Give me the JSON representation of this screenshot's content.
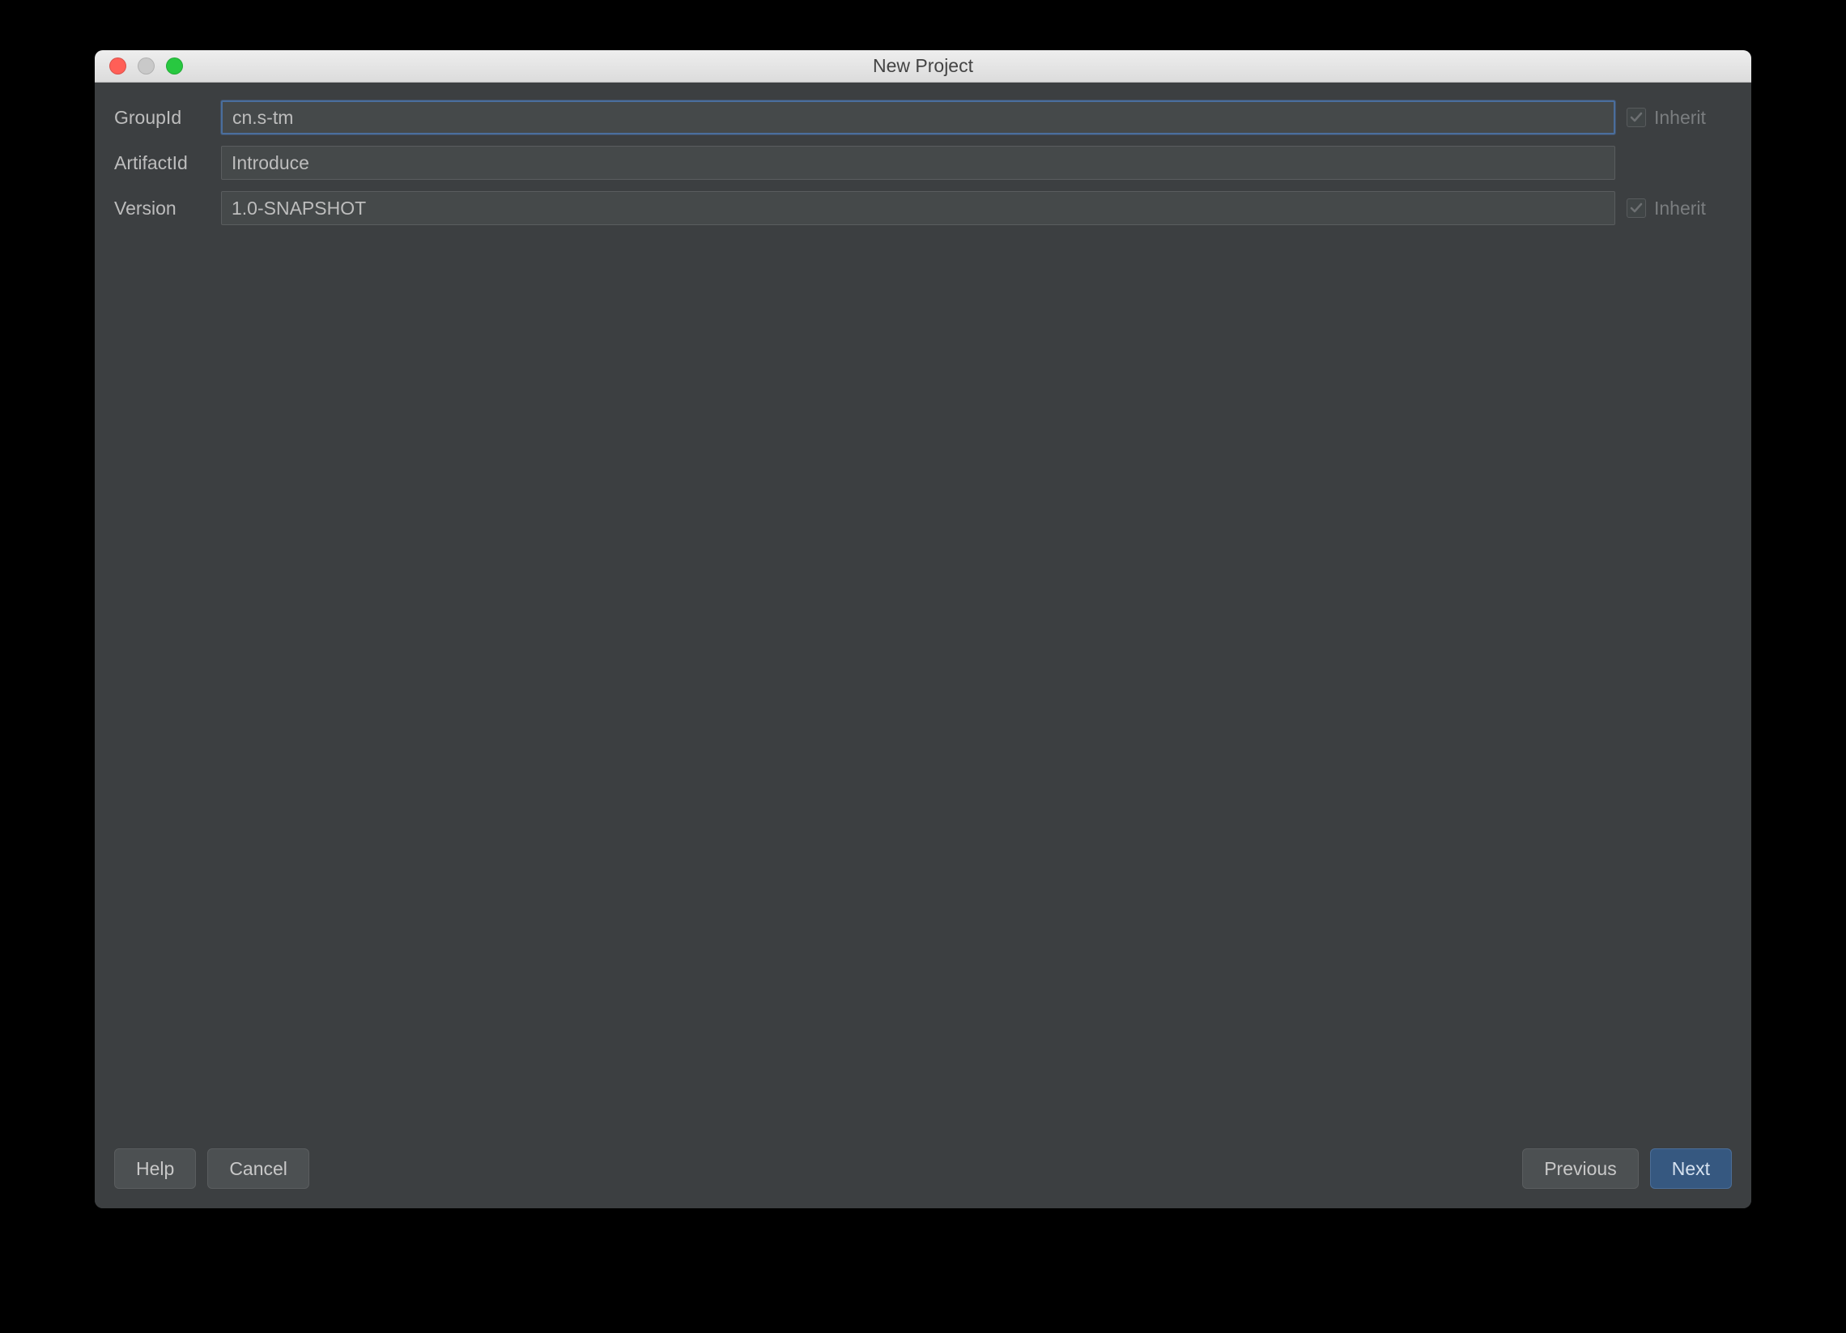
{
  "window": {
    "title": "New Project"
  },
  "fields": {
    "groupId": {
      "label": "GroupId",
      "value": "cn.s-tm",
      "inherit_label": "Inherit",
      "show_inherit": true
    },
    "artifactId": {
      "label": "ArtifactId",
      "value": "Introduce",
      "show_inherit": false
    },
    "version": {
      "label": "Version",
      "value": "1.0-SNAPSHOT",
      "inherit_label": "Inherit",
      "show_inherit": true
    }
  },
  "buttons": {
    "help": "Help",
    "cancel": "Cancel",
    "previous": "Previous",
    "next": "Next"
  }
}
